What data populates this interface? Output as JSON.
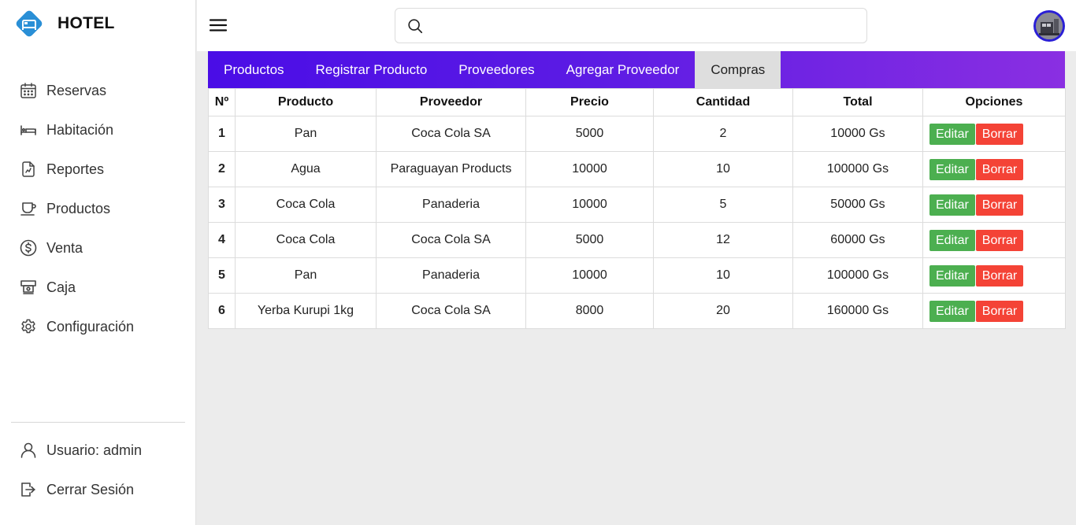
{
  "app": {
    "title": "HOTEL"
  },
  "sidebar": {
    "items": [
      {
        "label": "Reservas",
        "icon": "calendar-icon"
      },
      {
        "label": "Habitación",
        "icon": "bed-icon"
      },
      {
        "label": "Reportes",
        "icon": "report-icon"
      },
      {
        "label": "Productos",
        "icon": "cup-icon"
      },
      {
        "label": "Venta",
        "icon": "dollar-circle-icon"
      },
      {
        "label": "Caja",
        "icon": "cash-register-icon"
      },
      {
        "label": "Configuración",
        "icon": "gear-icon"
      }
    ],
    "bottom": [
      {
        "label": "Usuario: admin",
        "icon": "user-icon"
      },
      {
        "label": "Cerrar Sesión",
        "icon": "logout-icon"
      }
    ]
  },
  "header": {
    "search_value": "",
    "search_placeholder": ""
  },
  "tabs": [
    {
      "label": "Productos",
      "active": false
    },
    {
      "label": "Registrar Producto",
      "active": false
    },
    {
      "label": "Proveedores",
      "active": false
    },
    {
      "label": "Agregar Proveedor",
      "active": false
    },
    {
      "label": "Compras",
      "active": true
    }
  ],
  "table": {
    "columns": [
      "Nº",
      "Producto",
      "Proveedor",
      "Precio",
      "Cantidad",
      "Total",
      "Opciones"
    ],
    "rows": [
      [
        "1",
        "Pan",
        "Coca Cola SA",
        "5000",
        "2",
        "10000 Gs"
      ],
      [
        "2",
        "Agua",
        "Paraguayan Products",
        "10000",
        "10",
        "100000 Gs"
      ],
      [
        "3",
        "Coca Cola",
        "Panaderia",
        "10000",
        "5",
        "50000 Gs"
      ],
      [
        "4",
        "Coca Cola",
        "Coca Cola SA",
        "5000",
        "12",
        "60000 Gs"
      ],
      [
        "5",
        "Pan",
        "Panaderia",
        "10000",
        "10",
        "100000 Gs"
      ],
      [
        "6",
        "Yerba Kurupi 1kg",
        "Coca Cola SA",
        "8000",
        "20",
        "160000 Gs"
      ]
    ],
    "edit_label": "Editar",
    "delete_label": "Borrar"
  },
  "colors": {
    "brand": "#2a8fd6",
    "tab_gradient_start": "#4a0de6",
    "tab_gradient_end": "#8a2fe2",
    "edit_button": "#4caf50",
    "delete_button": "#f44336"
  }
}
